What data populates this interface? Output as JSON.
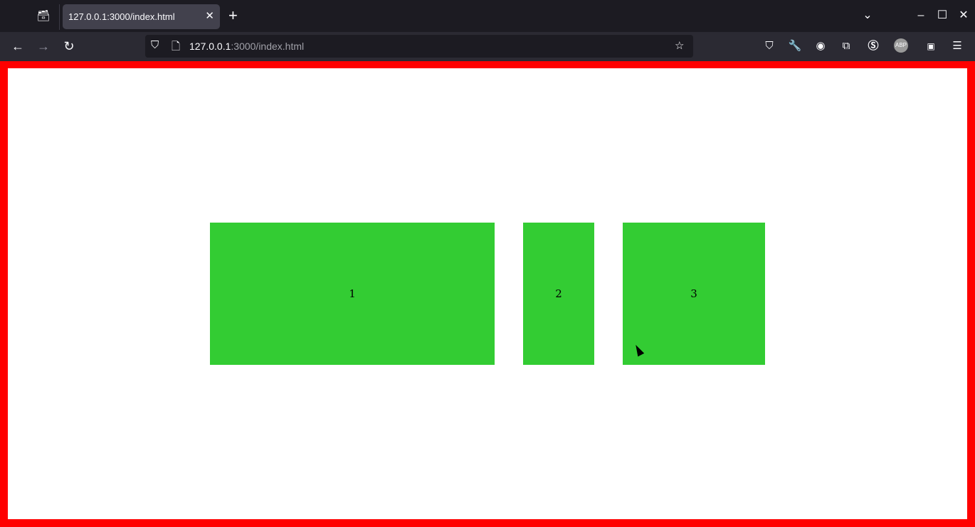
{
  "browser": {
    "tab_title": "127.0.0.1:3000/index.html",
    "url_host": "127.0.0.1",
    "url_rest": ":3000/index.html",
    "icons": [
      "tab-overview-icon",
      "close-icon",
      "plus-icon",
      "chevron-down-icon",
      "minimize-icon",
      "maximize-icon",
      "close-window-icon",
      "back-icon",
      "forward-icon",
      "reload-icon",
      "shield-icon",
      "page-icon",
      "star-icon",
      "pocket-icon",
      "wrench-icon",
      "account-icon",
      "extensions-icon",
      "s-extension-icon",
      "abp-icon",
      "image-extension-icon",
      "menu-icon"
    ]
  },
  "page": {
    "border_color": "#ff0000",
    "box_color": "#33cc33",
    "boxes": [
      {
        "label": "1"
      },
      {
        "label": "2"
      },
      {
        "label": "3"
      }
    ]
  }
}
